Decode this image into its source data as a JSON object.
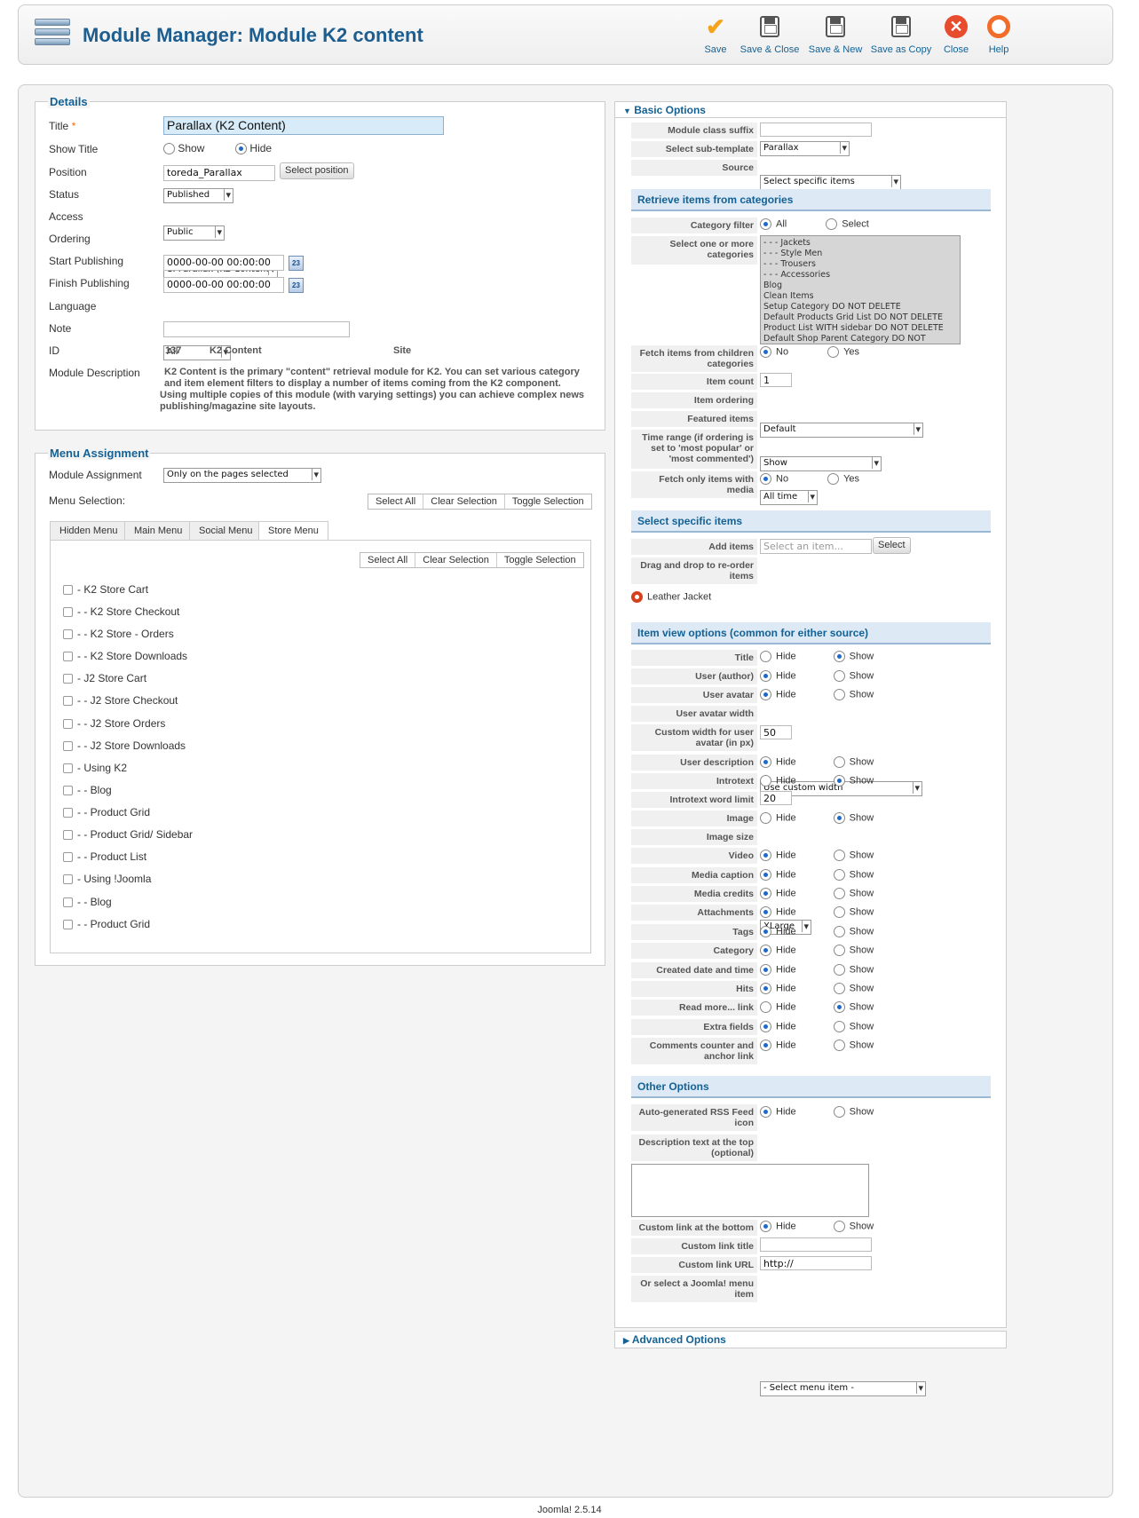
{
  "header": {
    "title": "Module Manager: Module K2 content"
  },
  "toolbar": {
    "save": "Save",
    "save_close": "Save & Close",
    "save_new": "Save & New",
    "save_copy": "Save as Copy",
    "close": "Close",
    "help": "Help"
  },
  "details": {
    "legend": "Details",
    "title_label": "Title",
    "title_required": "*",
    "title_value": "Parallax (K2 Content)",
    "show_title_label": "Show Title",
    "show_title_show": "Show",
    "show_title_hide": "Hide",
    "position_label": "Position",
    "position_value": "toreda_Parallax",
    "select_position": "Select position",
    "status_label": "Status",
    "status_value": "Published",
    "access_label": "Access",
    "access_value": "Public",
    "ordering_label": "Ordering",
    "ordering_value": "1. Parallax (K2 Content)",
    "start_label": "Start Publishing",
    "start_value": "0000-00-00 00:00:00",
    "finish_label": "Finish Publishing",
    "finish_value": "0000-00-00 00:00:00",
    "cal_label": "23",
    "language_label": "Language",
    "language_value": "All",
    "note_label": "Note",
    "note_value": "",
    "id_label": "ID",
    "id_value": "137",
    "id_type": "K2 Content",
    "id_client": "Site",
    "desc_label": "Module Description",
    "desc_line1": "K2 Content is the primary \"content\" retrieval module for K2. You can set various category",
    "desc_line2": "and item element filters to display a number of items coming from the K2 component.",
    "desc_line3": "Using multiple copies of this module (with varying settings) you can achieve complex news",
    "desc_line4": "publishing/magazine site layouts."
  },
  "menu": {
    "legend": "Menu Assignment",
    "assignment_label": "Module Assignment",
    "assignment_value": "Only on the pages selected",
    "selection_label": "Menu Selection:",
    "select_all": "Select All",
    "clear_selection": "Clear Selection",
    "toggle_selection": "Toggle Selection",
    "tabs": [
      "Hidden Menu",
      "Main Menu",
      "Social Menu",
      "Store Menu"
    ],
    "items": [
      "- K2 Store Cart",
      "- - K2 Store Checkout",
      "- - K2 Store - Orders",
      "- - K2 Store Downloads",
      "- J2 Store Cart",
      "- - J2 Store Checkout",
      "- - J2 Store Orders",
      "- - J2 Store Downloads",
      "- Using K2",
      "- - Blog",
      "- - Product Grid",
      "- - Product Grid/ Sidebar",
      "- - Product List",
      "- Using !Joomla",
      "- - Blog",
      "- - Product Grid"
    ]
  },
  "basic": {
    "header": "Basic Options",
    "class_suffix_label": "Module class suffix",
    "subtemplate_label": "Select sub-template",
    "subtemplate_value": "Parallax",
    "source_label": "Source",
    "source_value": "Select specific items",
    "retrieve_header": "Retrieve items from categories",
    "cat_filter_label": "Category filter",
    "cat_all": "All",
    "cat_select": "Select",
    "cats_label": "Select one or more categories",
    "categories": [
      "- - - Jackets",
      "- - - Style Men",
      "- - - Trousers",
      "- - - Accessories",
      "Blog",
      "Clean Items",
      "Setup Category DO NOT DELETE",
      "Default Products Grid List DO NOT DELETE",
      "Product List WITH sidebar DO NOT DELETE",
      "Default Shop Parent Category DO NOT DELETE"
    ],
    "fetch_children_label": "Fetch items from children categories",
    "no": "No",
    "yes": "Yes",
    "item_count_label": "Item count",
    "item_count_value": "1",
    "item_ordering_label": "Item ordering",
    "item_ordering_value": "Default",
    "featured_label": "Featured items",
    "featured_value": "Show",
    "time_range_label": "Time range (if ordering is set to 'most popular' or 'most commented')",
    "time_range_value": "All time",
    "media_only_label": "Fetch only items with media",
    "specific_header": "Select specific items",
    "add_items_label": "Add items",
    "add_items_placeholder": "Select an item...",
    "select_btn": "Select",
    "drag_label": "Drag and drop to re-order items",
    "selected_item": "Leather Jacket",
    "view_header": "Item view options (common for either source)",
    "hide": "Hide",
    "show": "Show",
    "title_label": "Title",
    "user_author_label": "User (author)",
    "user_avatar_label": "User avatar",
    "avatar_width_label": "User avatar width",
    "avatar_width_value": "Use custom width",
    "custom_width_label": "Custom width for user avatar (in px)",
    "custom_width_value": "50",
    "user_desc_label": "User description",
    "introtext_label": "Introtext",
    "introtext_limit_label": "Introtext word limit",
    "introtext_limit_value": "20",
    "image_label": "Image",
    "image_size_label": "Image size",
    "image_size_value": "XLarge",
    "video_label": "Video",
    "media_caption_label": "Media caption",
    "media_credits_label": "Media credits",
    "attachments_label": "Attachments",
    "tags_label": "Tags",
    "category_label": "Category",
    "created_label": "Created date and time",
    "hits_label": "Hits",
    "readmore_label": "Read more... link",
    "extra_label": "Extra fields",
    "comments_label": "Comments counter and anchor link",
    "other_header": "Other Options",
    "rss_label": "Auto-generated RSS Feed icon",
    "desc_text_label": "Description text at the top (optional)",
    "custom_link_label": "Custom link at the bottom",
    "custom_title_label": "Custom link title",
    "custom_url_label": "Custom link URL",
    "custom_url_value": "http://",
    "menu_item_label": "Or select a Joomla! menu item",
    "menu_item_value": "- Select menu item -"
  },
  "advanced": {
    "header": "Advanced Options"
  },
  "footer": {
    "version": "Joomla! 2.5.14"
  },
  "colors": {
    "accent": "#146295",
    "header_bg": "#dde9f4",
    "close_red": "#e74c2e",
    "save_check": "#f4a31b"
  }
}
